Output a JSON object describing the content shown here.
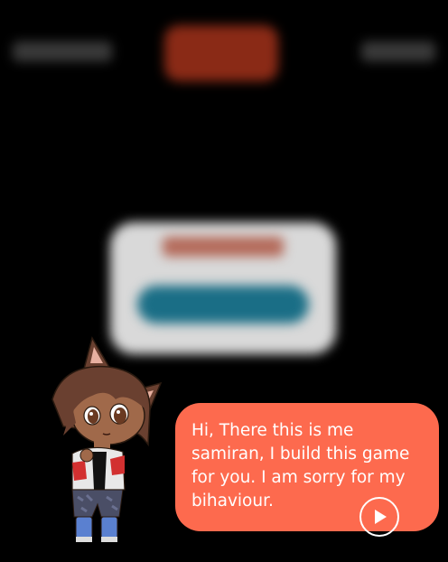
{
  "dialogue": {
    "text": "Hi, There this is me samiran, I build this game for you. I am sorry for my bihaviour.",
    "bubble_color": "#fd6a4e",
    "next_icon": "play-icon"
  },
  "character": {
    "name_icon": "cat-ear-boy-character"
  },
  "background": {
    "color": "#000000"
  }
}
